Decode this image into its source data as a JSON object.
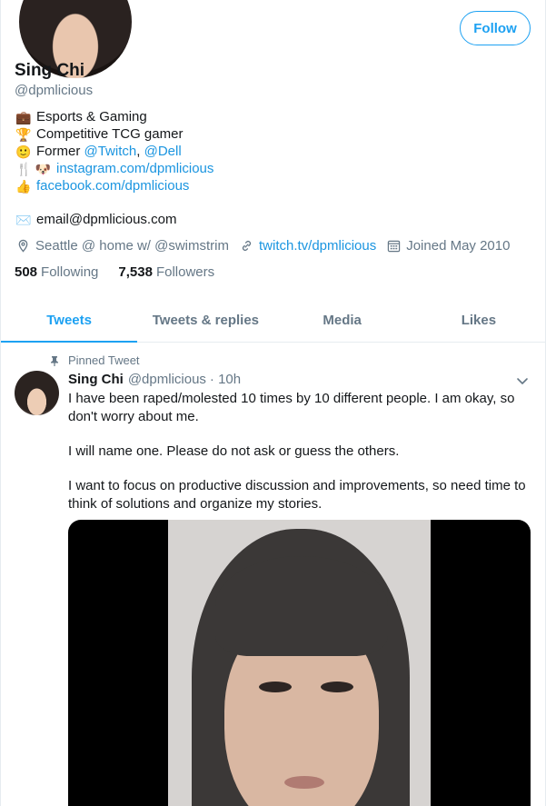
{
  "profile": {
    "follow_label": "Follow",
    "name": "Sing Chi",
    "handle": "@dpmlicious",
    "bio": [
      {
        "icon": "briefcase-icon",
        "emoji": "💼",
        "parts": [
          {
            "text": "Esports & Gaming",
            "link": false
          }
        ]
      },
      {
        "icon": "trophy-icon",
        "emoji": "🏆",
        "parts": [
          {
            "text": "Competitive TCG gamer",
            "link": false
          }
        ]
      },
      {
        "icon": "smiley-icon",
        "emoji": "🙂",
        "parts": [
          {
            "text": "Former ",
            "link": false
          },
          {
            "text": "@Twitch",
            "link": true
          },
          {
            "text": ", ",
            "link": false
          },
          {
            "text": "@Dell",
            "link": true
          }
        ]
      },
      {
        "icon": "fork-knife-dog-icon",
        "emoji": "🍴 🐶",
        "parts": [
          {
            "text": "instagram.com/dpmlicious",
            "link": true
          }
        ]
      },
      {
        "icon": "thumbs-up-icon",
        "emoji": "👍",
        "parts": [
          {
            "text": "facebook.com/dpmlicious",
            "link": true
          }
        ]
      }
    ],
    "email": "email@dpmlicious.com",
    "location": "Seattle @ home w/ @swimstrim",
    "website": "twitch.tv/dpmlicious",
    "joined": "Joined May 2010",
    "following_count": "508",
    "following_label": "Following",
    "followers_count": "7,538",
    "followers_label": "Followers"
  },
  "tabs": [
    {
      "label": "Tweets",
      "active": true
    },
    {
      "label": "Tweets & replies",
      "active": false
    },
    {
      "label": "Media",
      "active": false
    },
    {
      "label": "Likes",
      "active": false
    }
  ],
  "tweet": {
    "pinned_label": "Pinned Tweet",
    "name": "Sing Chi",
    "handle": "@dpmlicious",
    "time": "· 10h",
    "paragraphs": [
      "I have been raped/molested 10 times by 10 different people. I am okay, so don't worry about me.",
      "I will name one. Please do not ask or guess the others.",
      "I want to focus on productive discussion and improvements, so need time to think of solutions and organize my stories."
    ]
  },
  "colors": {
    "accent": "#1da1f2",
    "link": "#1b95e0",
    "secondary_text": "#657786",
    "border": "#e6ecf0"
  }
}
